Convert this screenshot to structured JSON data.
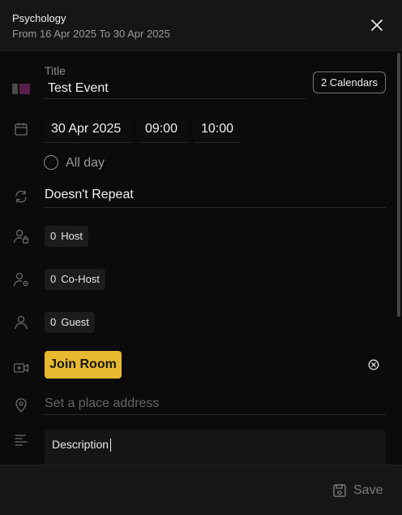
{
  "header": {
    "title": "Psychology",
    "subtitle": "From 16 Apr 2025 To 30 Apr 2025"
  },
  "form": {
    "title_label": "Title",
    "title_value": "Test Event",
    "calendars_button": "2 Calendars",
    "calendar_colors": [
      "#4a4a4a",
      "#5a1e4a"
    ],
    "date": "30 Apr 2025",
    "start_time": "09:00",
    "end_time": "10:00",
    "all_day_label": "All day",
    "all_day_checked": false,
    "repeat": "Doesn't Repeat",
    "host": {
      "count": "0",
      "label": "Host"
    },
    "cohost": {
      "count": "0",
      "label": "Co-Host"
    },
    "guest": {
      "count": "0",
      "label": "Guest"
    },
    "join_room_label": "Join Room",
    "join_room_color": "#e7b930",
    "place_placeholder": "Set a place address",
    "description_value": "Description"
  },
  "footer": {
    "save_label": "Save"
  },
  "icons": {
    "close": "close-icon",
    "calendar": "calendar-icon",
    "repeat": "repeat-icon",
    "host": "user-lock-icon",
    "cohost": "user-gear-icon",
    "guest": "user-icon",
    "video": "video-plus-icon",
    "location": "map-pin-icon",
    "description": "align-left-icon",
    "save": "floppy-disk-icon",
    "remove": "circle-x-icon"
  }
}
